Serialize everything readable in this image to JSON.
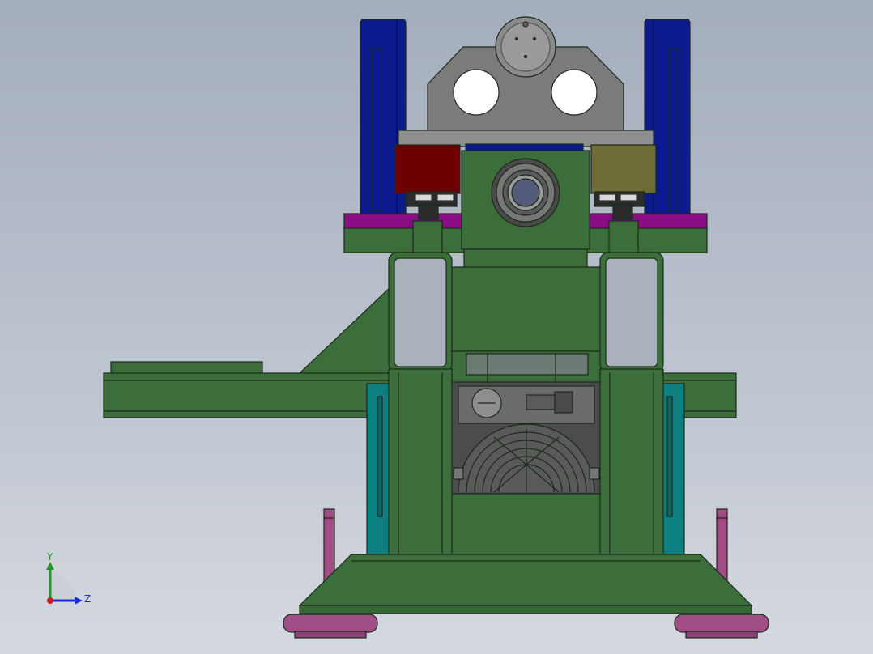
{
  "viewport": {
    "background_top": "#a4adbc",
    "background_bottom": "#d5d9df"
  },
  "colors": {
    "frame_green": "#3c6e3b",
    "dark_green": "#2f5a2e",
    "rail_blue": "#0b1a8c",
    "plate_purple": "#8b0d86",
    "block_red": "#6e0000",
    "block_olive": "#6d6c34",
    "teal": "#0d7f80",
    "foot_magenta": "#a24e86",
    "bracket_gray": "#7b7b7b",
    "outline": "#1a2a1a"
  },
  "triad": {
    "y_label": "Y",
    "z_label": "Z",
    "y_color": "#1d9b24",
    "z_color": "#1a2fd1",
    "origin_color": "#c81e1e"
  }
}
